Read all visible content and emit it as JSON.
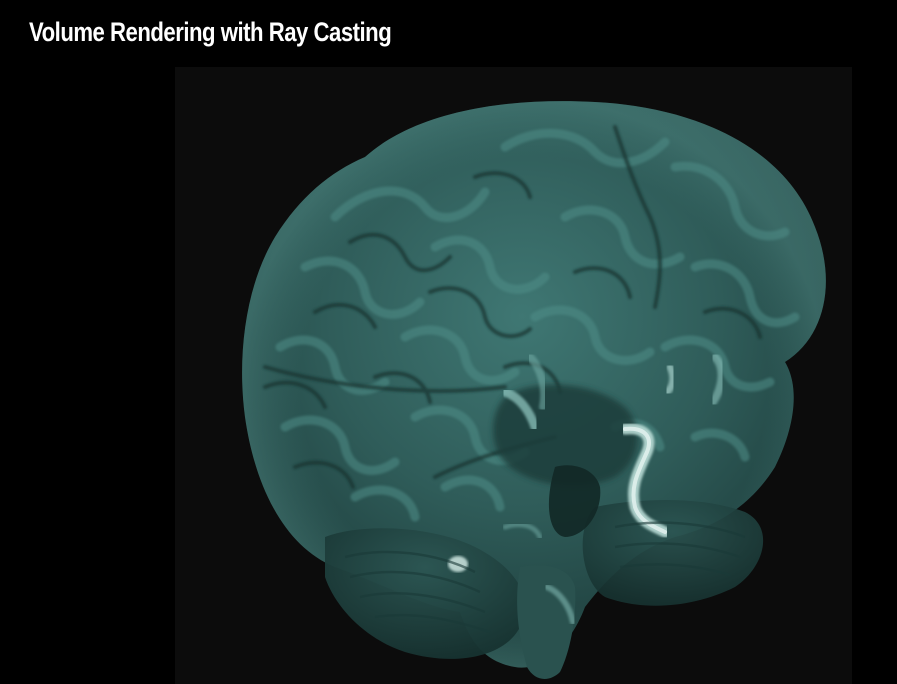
{
  "page": {
    "title": "Volume Rendering with Ray Casting"
  },
  "viewer": {
    "content": "brain-volume-render",
    "colors": {
      "background": "#0c0c0c",
      "tissue_base": "#2f5c59",
      "tissue_light": "#4e8c87",
      "tissue_dark": "#1a3937",
      "vessel_highlight": "#b9dcd6"
    }
  }
}
